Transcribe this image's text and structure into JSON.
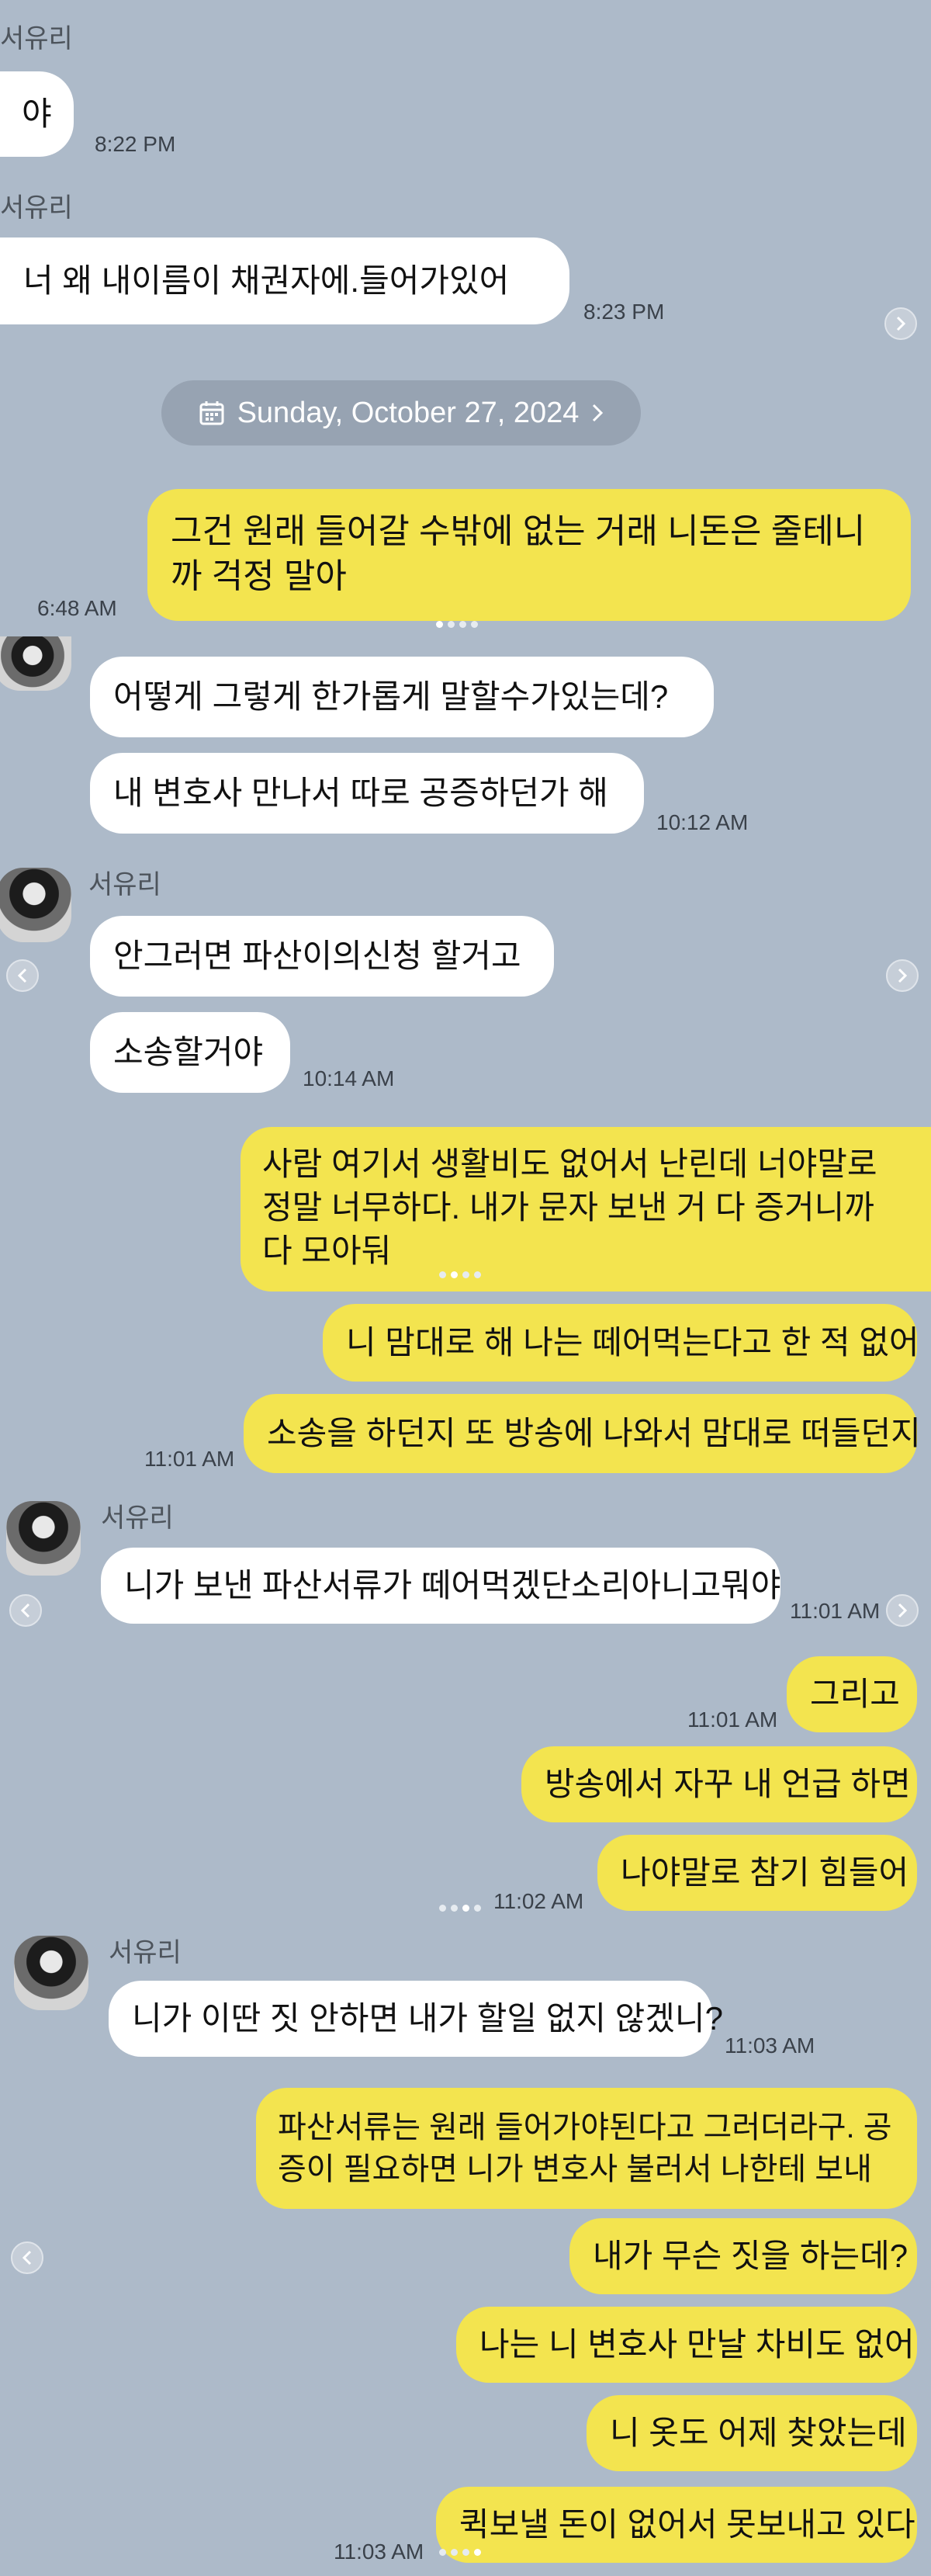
{
  "chat": {
    "contact_name": "서유리",
    "date_divider": "Sunday, October 27, 2024",
    "messages": {
      "m1": {
        "text": "야",
        "time": "8:22 PM"
      },
      "m2": {
        "text": "너 왜 내이름이 채권자에.들어가있어",
        "time": "8:23 PM"
      },
      "m3": {
        "text": "그건 원래 들어갈 수밖에 없는 거래 니돈은 줄테니까 걱정 말아",
        "time": "6:48 AM"
      },
      "m4": {
        "text": "어떻게 그렇게 한가롭게 말할수가있는데?"
      },
      "m5": {
        "text": "내 변호사 만나서 따로 공증하던가 해",
        "time": "10:12 AM"
      },
      "m6": {
        "text": "안그러면 파산이의신청 할거고"
      },
      "m7": {
        "text": "소송할거야",
        "time": "10:14 AM"
      },
      "m8": {
        "text": "사람 여기서 생활비도 없어서 난린데 너야말로 정말 너무하다. 내가 문자 보낸 거 다 증거니까  다 모아둬"
      },
      "m9": {
        "text": "니 맘대로 해 나는 떼어먹는다고 한 적 없어"
      },
      "m10": {
        "text": "소송을 하던지 또 방송에 나와서 맘대로 떠들던지",
        "time": "11:01 AM"
      },
      "m11": {
        "text": "니가 보낸 파산서류가 떼어먹겠단소리아니고뭐야",
        "time": "11:01 AM"
      },
      "m12": {
        "text": "그리고",
        "time": "11:01 AM"
      },
      "m13": {
        "text": "방송에서 자꾸 내 언급 하면"
      },
      "m14": {
        "text": "나야말로 참기 힘들어",
        "time": "11:02 AM"
      },
      "m15": {
        "text": "니가 이딴 짓 안하면 내가 할일 없지 않겠니?",
        "time": "11:03 AM"
      },
      "m16": {
        "text": "파산서류는 원래 들어가야된다고 그러더라구. 공증이 필요하면 니가 변호사 불러서 나한테 보내"
      },
      "m17": {
        "text": "내가 무슨 짓을 하는데?"
      },
      "m18": {
        "text": "나는 니 변호사 만날 차비도 없어"
      },
      "m19": {
        "text": "니 옷도 어제 찾았는데"
      },
      "m20": {
        "text": "퀵보낼 돈이 없어서 못보내고 있다",
        "time": "11:03 AM"
      }
    }
  },
  "icons": {
    "calendar": "calendar-icon",
    "chevron_right": "chevron-right-icon",
    "chevron_left": "chevron-left-icon"
  },
  "colors": {
    "background": "#adbac9",
    "incoming_bubble": "#ffffff",
    "outgoing_bubble": "#f3e44f",
    "date_pill": "#97a3b2"
  }
}
